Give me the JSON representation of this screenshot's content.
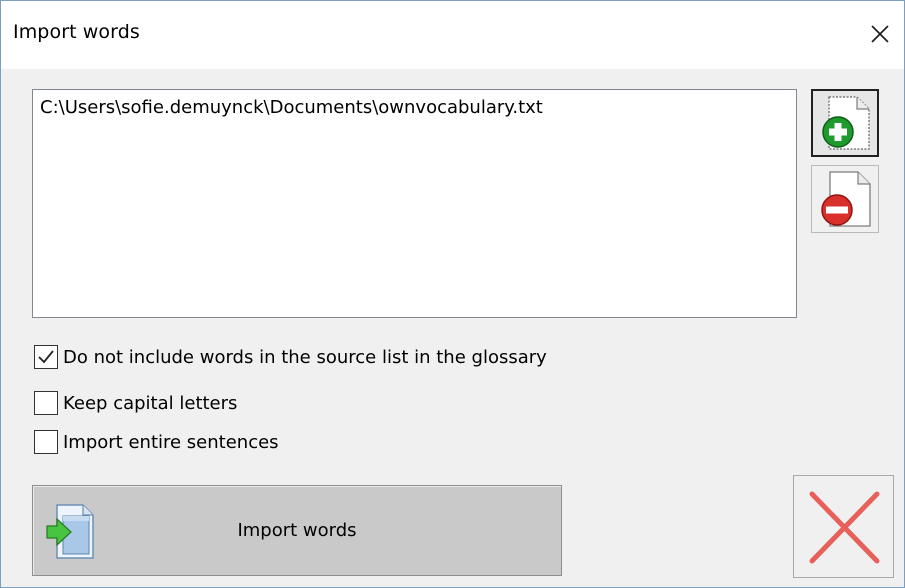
{
  "window": {
    "title": "Import words"
  },
  "file_list": {
    "items": [
      "C:\\Users\\sofie.demuynck\\Documents\\ownvocabulary.txt"
    ]
  },
  "side_buttons": {
    "add_icon": "add-file-icon",
    "remove_icon": "remove-file-icon"
  },
  "options": [
    {
      "label": "Do not include words in the source list in the glossary",
      "checked": true
    },
    {
      "label": "Keep capital letters",
      "checked": false
    },
    {
      "label": "Import entire sentences",
      "checked": false
    }
  ],
  "import_button": {
    "label": "Import words",
    "icon": "import-document-icon"
  },
  "cancel_button": {
    "icon": "red-x-icon"
  },
  "colors": {
    "add_green": "#1f9a2e",
    "remove_red": "#d9302b",
    "cancel_red": "#e8605a",
    "import_arrow_green": "#49c442"
  }
}
